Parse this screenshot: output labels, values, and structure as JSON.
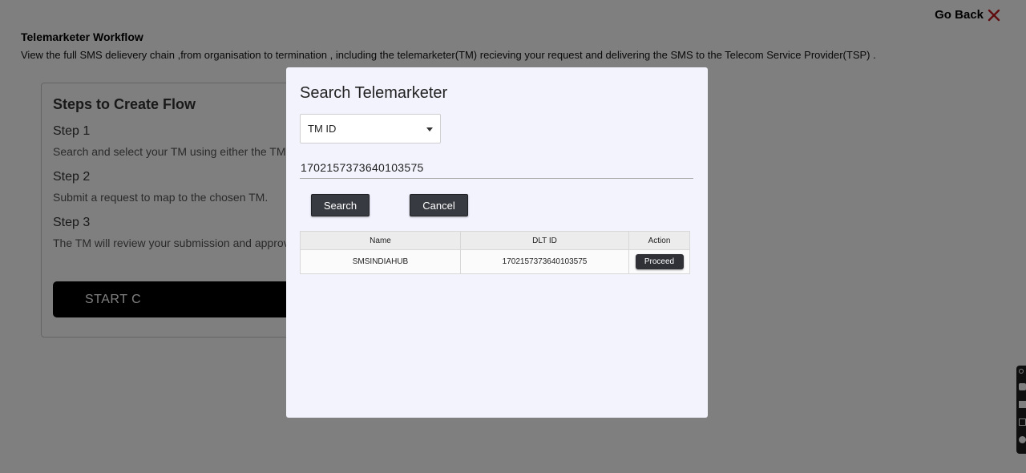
{
  "header": {
    "go_back_label": "Go Back",
    "go_back_icon": "close-x-icon",
    "go_back_icon_color": "#c0181f"
  },
  "page": {
    "title": "Telemarketer Workflow",
    "description": "View the full SMS delievery chain ,from organisation to termination , including the telemarketer(TM) recieving your request and delivering the SMS to the Telecom Service Provider(TSP) ."
  },
  "steps_card": {
    "title": "Steps to Create Flow",
    "steps": [
      {
        "label": "Step 1",
        "desc": "Search and select your TM using either the TM"
      },
      {
        "label": "Step 2",
        "desc": "Submit a request to map to the chosen TM."
      },
      {
        "label": "Step 3",
        "desc": "The TM will review your submission and approv"
      }
    ],
    "start_button": "START C"
  },
  "modal": {
    "title": "Search Telemarketer",
    "select_value": "TM ID",
    "input_value": "1702157373640103575",
    "search_label": "Search",
    "cancel_label": "Cancel",
    "table": {
      "headers": [
        "Name",
        "DLT ID",
        "Action"
      ],
      "rows": [
        {
          "name": "SMSINDIAHUB",
          "dlt_id": "1702157373640103575",
          "action": "Proceed"
        }
      ]
    }
  },
  "side_toolbar": {
    "icons": [
      "link-icon",
      "camera-icon",
      "square-icon",
      "window-icon",
      "gear-icon"
    ]
  }
}
